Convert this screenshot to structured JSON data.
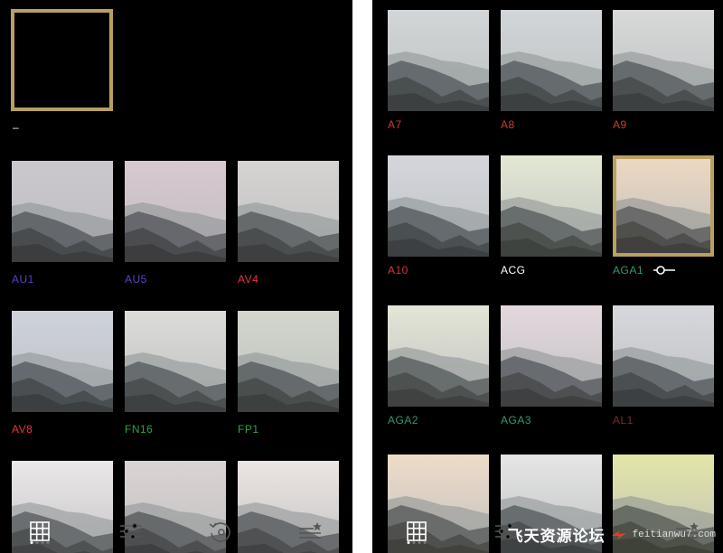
{
  "left": {
    "original_label": "–",
    "filters": [
      {
        "label": "AU1",
        "color": "#5a44c8",
        "tint": "#ccc7cf"
      },
      {
        "label": "AU5",
        "color": "#5a44c8",
        "tint": "#d9c9d0"
      },
      {
        "label": "AV4",
        "color": "#e0383f",
        "tint": "#d6d4d2"
      },
      {
        "label": "AV8",
        "color": "#e0383f",
        "tint": "#cfd3db"
      },
      {
        "label": "FN16",
        "color": "#2ea54a",
        "tint": "#dcdcd9"
      },
      {
        "label": "FP1",
        "color": "#2ea54a",
        "tint": "#d2d6cc"
      },
      {
        "label": "",
        "color": "#fff",
        "tint": "#ece8ea"
      },
      {
        "label": "",
        "color": "#fff",
        "tint": "#dcd4d4"
      },
      {
        "label": "",
        "color": "#fff",
        "tint": "#ece6e2"
      }
    ]
  },
  "right": {
    "filters": [
      {
        "label": "A7",
        "color": "#d03a3a",
        "tint": "#d3d6d8"
      },
      {
        "label": "A8",
        "color": "#d03a3a",
        "tint": "#d2d6d9"
      },
      {
        "label": "A9",
        "color": "#d03a3a",
        "tint": "#d8dada"
      },
      {
        "label": "A10",
        "color": "#d03a3a",
        "tint": "#d5d6dc"
      },
      {
        "label": "ACG",
        "color": "#ffffff",
        "tint": "#e4e8d4"
      },
      {
        "label": "AGA1",
        "color": "#2e9b6e",
        "tint": "#ecd8c2"
      },
      {
        "label": "AGA2",
        "color": "#2e9b6e",
        "tint": "#e4e6d8"
      },
      {
        "label": "AGA3",
        "color": "#2e9b6e",
        "tint": "#e4d8de"
      },
      {
        "label": "AL1",
        "color": "#7a2c2c",
        "tint": "#d6d8dc"
      },
      {
        "label": "",
        "color": "#fff",
        "tint": "#eedcca"
      },
      {
        "label": "",
        "color": "#fff",
        "tint": "#e6e6e6"
      },
      {
        "label": "",
        "color": "#fff",
        "tint": "#e4e6a8"
      }
    ]
  },
  "nav": {
    "items": [
      "grid-icon",
      "sliders-icon",
      "undo-icon",
      "favorites-icon"
    ]
  },
  "watermark": {
    "main": "飞天资源论坛",
    "url": "feitianwu7.com"
  }
}
